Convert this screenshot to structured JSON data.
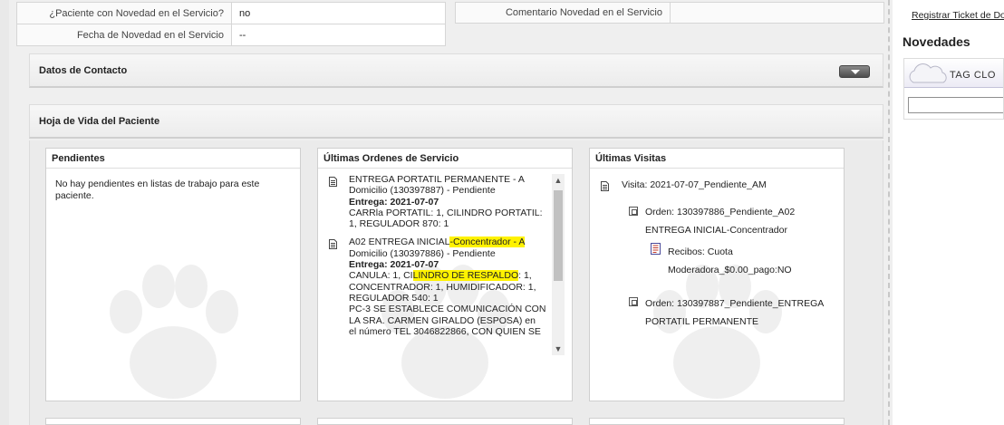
{
  "info": {
    "novedad_label": "¿Paciente con Novedad en el Servicio?",
    "novedad_value": "no",
    "fecha_label": "Fecha de Novedad en el Servicio",
    "fecha_value": "--",
    "comentario_label": "Comentario Novedad en el Servicio"
  },
  "sections": {
    "contacto": "Datos de Contacto",
    "hoja_vida": "Hoja de Vida del Paciente"
  },
  "pendientes": {
    "title": "Pendientes",
    "text": "No hay pendientes en listas de trabajo para este paciente."
  },
  "ordenes": {
    "title": "Últimas Ordenes de Servicio",
    "items": [
      {
        "line1": "ENTREGA PORTATIL PERMANENTE - A",
        "line2": "Domicilio (130397887) - Pendiente",
        "entrega": "Entrega: 2021-07-07",
        "detail1": "CARRla PORTATIL: 1, CILINDRO PORTATIL:",
        "detail2": "1, REGULADOR 870: 1"
      },
      {
        "line1a": "A02 ENTREGA INICIAL",
        "line1b": "-Concentrador - A",
        "line2": "Domicilio (130397886) - Pendiente",
        "entrega": "Entrega: 2021-07-07",
        "detail1a": "CANULA: 1, CI",
        "detail1b": "LINDRO DE RESPALDO",
        "detail1c": ": 1,",
        "detail2": "CONCENTRADOR: 1, HUMIDIFICADOR: 1,",
        "detail3": "REGULADOR 540: 1",
        "detail4": "PC-3 SE ESTABLECE COMUNICACIÓN CON",
        "detail5": "LA SRA. CARMEN GIRALDO (ESPOSA) en",
        "detail6": "el número TEL 3046822866, CON QUIEN SE"
      }
    ]
  },
  "visitas": {
    "title": "Últimas Visitas",
    "visita": "Visita: 2021-07-07_Pendiente_AM",
    "orden1a": "Orden: 130397886_Pendiente_A02",
    "orden1b": "ENTREGA INICIAL-Concentrador",
    "recibo_a": "Recibos: Cuota",
    "recibo_b": "Moderadora_$0.00_pago:NO",
    "orden2a": "Orden: 130397887_Pendiente_ENTREGA",
    "orden2b": "PORTATIL PERMANENTE"
  },
  "sidebar": {
    "link": "Registrar Ticket de Do",
    "novedades": "Novedades",
    "tag_label": "TAG  CLO"
  }
}
